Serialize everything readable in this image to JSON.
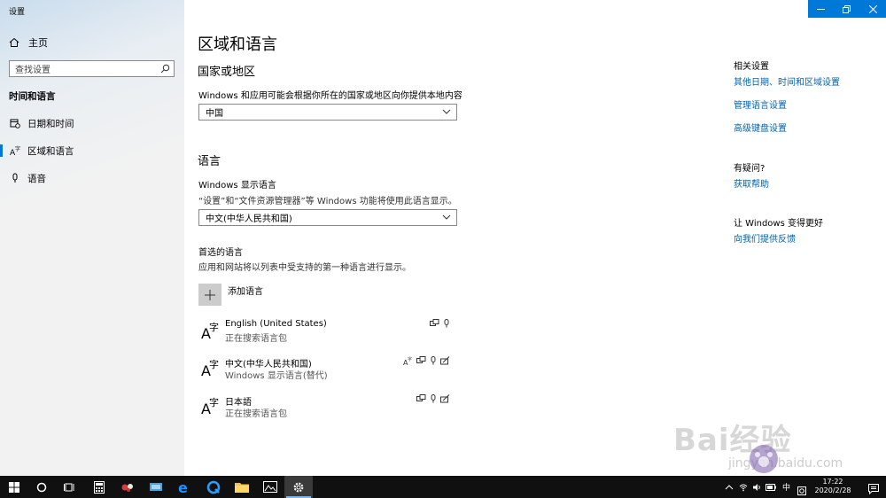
{
  "window": {
    "app_title": "设置",
    "colors": {
      "accent": "#0078d7",
      "link": "#0063b1",
      "sidebar_bg": "#f2f2f2"
    }
  },
  "sidebar": {
    "home_label": "主页",
    "search_placeholder": "查找设置",
    "section_title": "时间和语言",
    "items": [
      {
        "label": "日期和时间",
        "icon": "calendar-clock-icon"
      },
      {
        "label": "区域和语言",
        "icon": "language-icon",
        "selected": true
      },
      {
        "label": "语音",
        "icon": "microphone-icon"
      }
    ]
  },
  "main": {
    "title": "区域和语言",
    "region": {
      "heading": "国家或地区",
      "label": "Windows 和应用可能会根据你所在的国家或地区向你提供本地内容",
      "selected": "中国"
    },
    "language": {
      "heading": "语言",
      "display_label": "Windows 显示语言",
      "display_desc": "“设置”和“文件资源管理器”等 Windows 功能将使用此语言显示。",
      "display_selected": "中文(中华人民共和国)",
      "preferred_label": "首选的语言",
      "preferred_desc": "应用和网站将以列表中受支持的第一种语言进行显示。",
      "add_label": "添加语言",
      "list": [
        {
          "name": "English (United States)",
          "status": "正在搜索语言包",
          "caps": [
            "display-icon",
            "microphone-icon"
          ]
        },
        {
          "name": "中文(中华人民共和国)",
          "status": "Windows 显示语言(替代)",
          "caps": [
            "language-icon",
            "display-icon",
            "microphone-icon",
            "handwriting-icon"
          ]
        },
        {
          "name": "日本語",
          "status": "正在搜索语言包",
          "caps": [
            "display-icon",
            "microphone-icon",
            "handwriting-icon"
          ]
        }
      ]
    }
  },
  "related": {
    "heading": "相关设置",
    "links": [
      "其他日期、时间和区域设置",
      "管理语言设置",
      "高级键盘设置"
    ],
    "help_heading": "有疑问?",
    "help_link": "获取帮助",
    "feedback_heading": "让 Windows 变得更好",
    "feedback_link": "向我们提供反馈"
  },
  "taskbar": {
    "ime": "中",
    "time": "17:22",
    "date": "2020/2/28"
  },
  "watermark": {
    "brand": "Bai经验",
    "url": "jingyan.baidu.com"
  }
}
